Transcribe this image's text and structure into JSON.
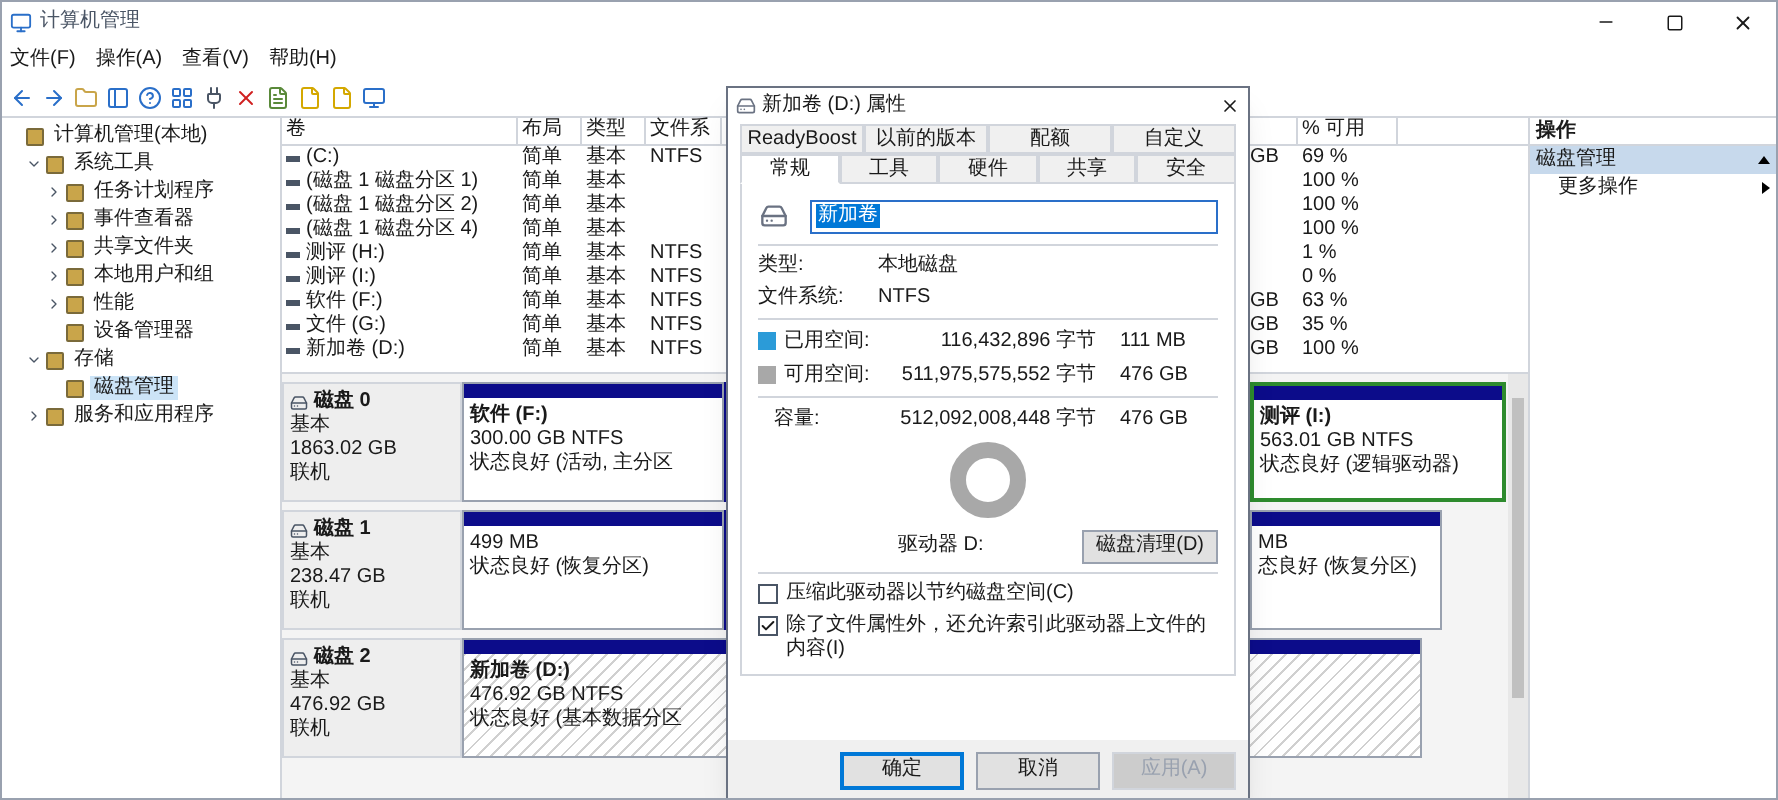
{
  "window": {
    "title": "计算机管理"
  },
  "menu": [
    "文件(F)",
    "操作(A)",
    "查看(V)",
    "帮助(H)"
  ],
  "tree": [
    {
      "label": "计算机管理(本地)",
      "selected": false,
      "children": [
        {
          "label": "系统工具",
          "selected": false,
          "expanded": true,
          "children": [
            {
              "label": "任务计划程序",
              "selected": false,
              "expanded": false
            },
            {
              "label": "事件查看器",
              "selected": false,
              "expanded": false
            },
            {
              "label": "共享文件夹",
              "selected": false,
              "expanded": false
            },
            {
              "label": "本地用户和组",
              "selected": false,
              "expanded": false
            },
            {
              "label": "性能",
              "selected": false,
              "expanded": false
            },
            {
              "label": "设备管理器",
              "selected": false
            }
          ]
        },
        {
          "label": "存储",
          "selected": false,
          "expanded": true,
          "children": [
            {
              "label": "磁盘管理",
              "selected": true
            }
          ]
        },
        {
          "label": "服务和应用程序",
          "selected": false,
          "expanded": false
        }
      ]
    }
  ],
  "table": {
    "columns": [
      "卷",
      "布局",
      "类型",
      "文件系",
      null,
      "% 可用"
    ],
    "rows": [
      [
        "(C:)",
        "简单",
        "基本",
        "NTFS",
        "GB",
        "69 %"
      ],
      [
        "(磁盘 1 磁盘分区 1)",
        "简单",
        "基本",
        null,
        null,
        "100 %"
      ],
      [
        "(磁盘 1 磁盘分区 2)",
        "简单",
        "基本",
        null,
        null,
        "100 %"
      ],
      [
        "(磁盘 1 磁盘分区 4)",
        "简单",
        "基本",
        null,
        null,
        "100 %"
      ],
      [
        "测评 (H:)",
        "简单",
        "基本",
        "NTFS",
        null,
        "1 %"
      ],
      [
        "测评 (I:)",
        "简单",
        "基本",
        "NTFS",
        null,
        "0 %"
      ],
      [
        "软件 (F:)",
        "简单",
        "基本",
        "NTFS",
        "GB",
        "63 %"
      ],
      [
        "文件 (G:)",
        "简单",
        "基本",
        "NTFS",
        "GB",
        "35 %"
      ],
      [
        "新加卷 (D:)",
        "简单",
        "基本",
        "NTFS",
        "GB",
        "100 %"
      ]
    ]
  },
  "disks": [
    {
      "name": "磁盘 0",
      "type": "基本",
      "size": "1863.02 GB",
      "status": "联机",
      "partitions": [
        {
          "kind": "primary",
          "selected": false,
          "label": "软件 (F:)",
          "details": [
            "300.00 GB NTFS",
            "状态良好 (活动, 主分区"
          ]
        },
        {
          "kind": "logical",
          "selected": false,
          "label": "测评 (I:)",
          "details": [
            "563.01 GB NTFS",
            "状态良好 (逻辑驱动器)"
          ]
        }
      ]
    },
    {
      "name": "磁盘 1",
      "type": "基本",
      "size": "238.47 GB",
      "status": "联机",
      "partitions": [
        {
          "kind": "primary",
          "selected": false,
          "details": [
            "499 MB",
            "状态良好 (恢复分区)"
          ]
        },
        {
          "kind": "primary",
          "selected": false,
          "details": [
            "MB",
            "态良好 (恢复分区)"
          ]
        }
      ]
    },
    {
      "name": "磁盘 2",
      "type": "基本",
      "size": "476.92 GB",
      "status": "联机",
      "partitions": [
        {
          "kind": "primary",
          "selected": true,
          "label": "新加卷 (D:)",
          "details": [
            "476.92 GB NTFS",
            "状态良好 (基本数据分区"
          ]
        }
      ]
    }
  ],
  "actions": {
    "title": "操作",
    "sections": [
      {
        "label": "磁盘管理",
        "expanded": true,
        "items": [
          "更多操作"
        ]
      }
    ]
  },
  "dialog": {
    "title": "新加卷 (D:) 属性",
    "tab_rows": [
      [
        {
          "label": "ReadyBoost",
          "selected": false
        },
        {
          "label": "以前的版本",
          "selected": false
        },
        {
          "label": "配额",
          "selected": false
        },
        {
          "label": "自定义",
          "selected": false
        }
      ],
      [
        {
          "label": "常规",
          "selected": true
        },
        {
          "label": "工具",
          "selected": false
        },
        {
          "label": "硬件",
          "selected": false
        },
        {
          "label": "共享",
          "selected": false
        },
        {
          "label": "安全",
          "selected": false
        }
      ]
    ],
    "name_value": "新加卷",
    "info": [
      {
        "label": "类型:",
        "value": "本地磁盘"
      },
      {
        "label": "文件系统:",
        "value": "NTFS"
      }
    ],
    "space": [
      {
        "label": "已用空间:",
        "bytes": "116,432,896 字节",
        "size": "111 MB",
        "color": "#2b9bd8"
      },
      {
        "label": "可用空间:",
        "bytes": "511,975,575,552 字节",
        "size": "476 GB",
        "color": "#a8a8a8"
      }
    ],
    "capacity": {
      "label": "容量:",
      "bytes": "512,092,008,448 字节",
      "size": "476 GB"
    },
    "drive_label": "驱动器 D:",
    "cleanup_button": "磁盘清理(D)",
    "options": [
      {
        "label": "压缩此驱动器以节约磁盘空间(C)",
        "checked": false
      },
      {
        "label": "除了文件属性外，还允许索引此驱动器上文件的内容(I)",
        "checked": true
      }
    ],
    "buttons": [
      {
        "label": "确定",
        "kind": "default"
      },
      {
        "label": "取消",
        "kind": "normal"
      },
      {
        "label": "应用(A)",
        "kind": "disabled"
      }
    ]
  }
}
